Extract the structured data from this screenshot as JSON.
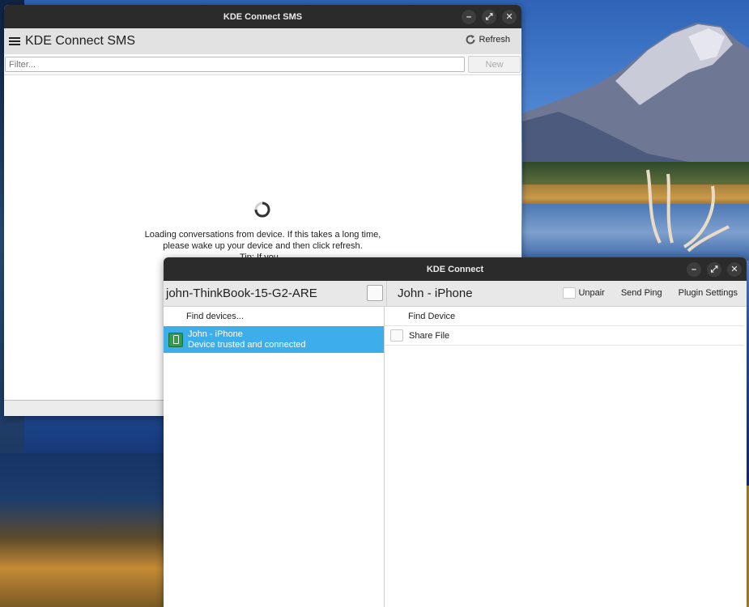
{
  "sms_window": {
    "title": "KDE Connect SMS",
    "app_title": "KDE Connect SMS",
    "refresh_label": "Refresh",
    "filter_placeholder": "Filter...",
    "new_label": "New",
    "loading_line1": "Loading conversations from device. If this takes a long time,",
    "loading_line2": "please wake up your device and then click refresh.",
    "tip_text": "Tip: If you..."
  },
  "kdeconnect_window": {
    "title": "KDE Connect",
    "host_name": "john-ThinkBook-15-G2-ARE",
    "device_title": "John  - iPhone",
    "unpair_label": "Unpair",
    "send_ping_label": "Send Ping",
    "plugin_settings_label": "Plugin Settings",
    "find_devices_label": "Find devices...",
    "devices": [
      {
        "name": "John  - iPhone",
        "status": "Device trusted and connected"
      }
    ],
    "plugins": [
      {
        "label": "Find Device"
      },
      {
        "label": "Share File"
      }
    ]
  },
  "window_controls": {
    "minimize": "–",
    "maximize": "⤢",
    "close": "✕"
  },
  "colors": {
    "selection": "#3daee9",
    "titlebar": "#2b2b2b"
  }
}
